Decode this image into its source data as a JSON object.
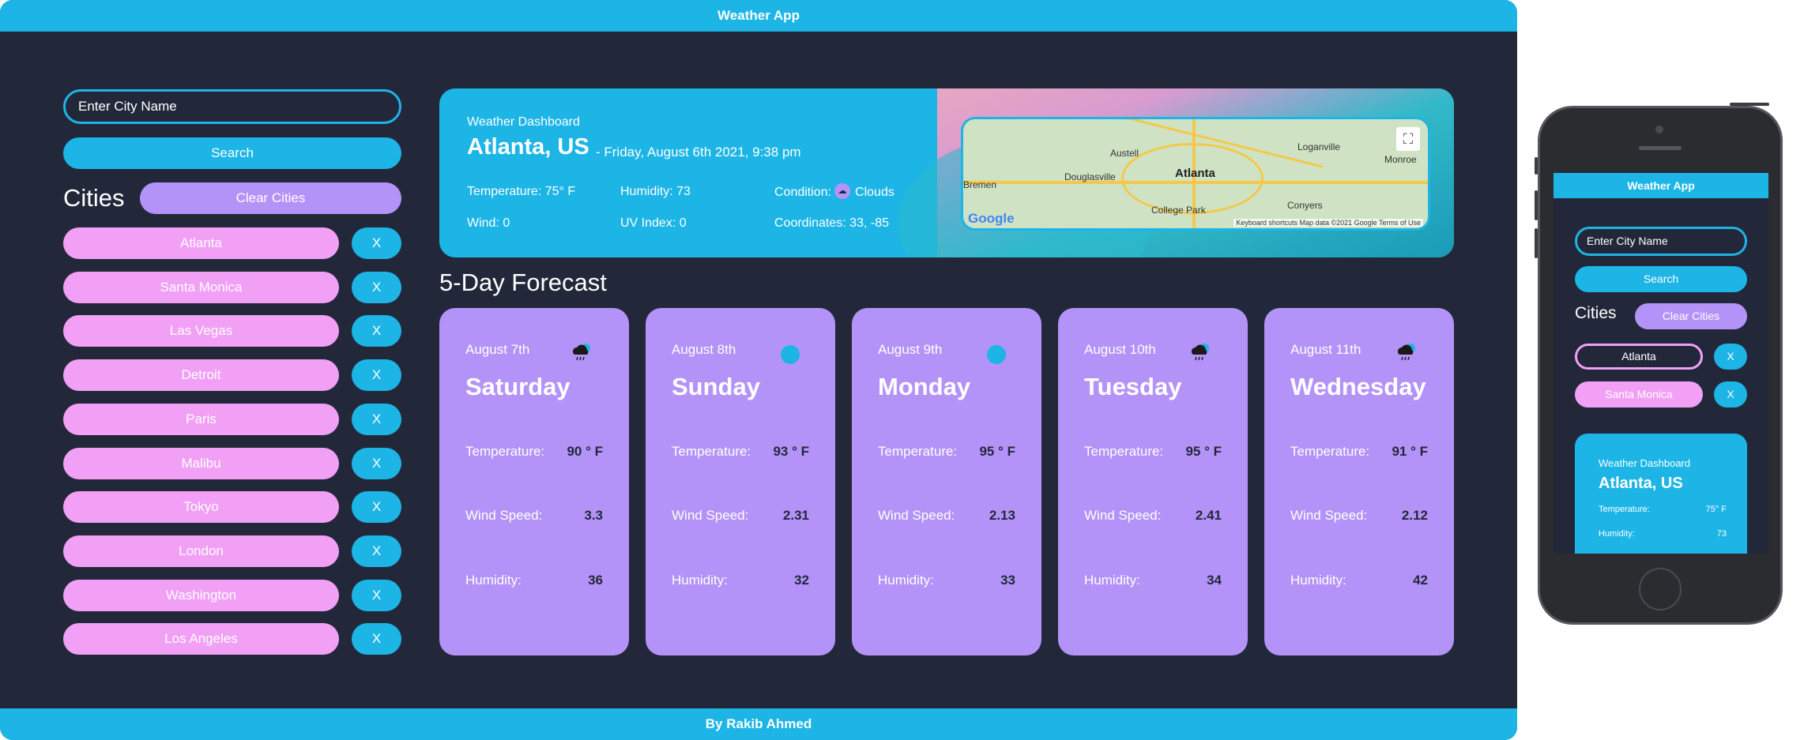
{
  "app": {
    "title": "Weather App",
    "footer": "By Rakib Ahmed"
  },
  "search": {
    "placeholder": "Enter City Name",
    "button": "Search"
  },
  "cities": {
    "heading": "Cities",
    "clear_label": "Clear Cities",
    "remove_label": "X",
    "items": [
      "Atlanta",
      "Santa Monica",
      "Las Vegas",
      "Detroit",
      "Paris",
      "Malibu",
      "Tokyo",
      "London",
      "Washington",
      "Los Angeles"
    ]
  },
  "dashboard": {
    "subtitle": "Weather Dashboard",
    "city": "Atlanta, US",
    "date": "- Friday, August 6th 2021, 9:38 pm",
    "temperature_label": "Temperature:",
    "temperature": "75° F",
    "humidity_label": "Humidity:",
    "humidity": "73",
    "condition_label": "Condition:",
    "condition": "Clouds",
    "wind_label": "Wind:",
    "wind": "0",
    "uv_label": "UV Index:",
    "uv": "0",
    "coords_label": "Coordinates:",
    "coords": "33, -85"
  },
  "map": {
    "city_label": "Atlanta",
    "places": [
      "Austell",
      "Douglasville",
      "Loganville",
      "Bremen",
      "College Park",
      "Conyers",
      "Monroe"
    ],
    "google": "Google",
    "footer_text": "Keyboard shortcuts   Map data ©2021 Google   Terms of Use"
  },
  "forecast": {
    "title": "5-Day Forecast",
    "labels": {
      "temperature": "Temperature:",
      "wind": "Wind Speed:",
      "humidity": "Humidity:"
    },
    "days": [
      {
        "date": "August 7th",
        "day": "Saturday",
        "icon": "rain-cloud-icon",
        "temp": "90 ° F",
        "wind": "3.3",
        "humidity": "36"
      },
      {
        "date": "August 8th",
        "day": "Sunday",
        "icon": "sun-icon",
        "temp": "93 ° F",
        "wind": "2.31",
        "humidity": "32"
      },
      {
        "date": "August 9th",
        "day": "Monday",
        "icon": "sun-icon",
        "temp": "95 ° F",
        "wind": "2.13",
        "humidity": "33"
      },
      {
        "date": "August 10th",
        "day": "Tuesday",
        "icon": "rain-cloud-icon",
        "temp": "95 ° F",
        "wind": "2.41",
        "humidity": "34"
      },
      {
        "date": "August 11th",
        "day": "Wednesday",
        "icon": "rain-cloud-icon",
        "temp": "91 ° F",
        "wind": "2.12",
        "humidity": "42"
      }
    ]
  },
  "phone": {
    "title": "Weather App",
    "placeholder": "Enter City Name",
    "search": "Search",
    "cities_heading": "Cities",
    "clear_label": "Clear Cities",
    "remove_label": "X",
    "cities": [
      "Atlanta",
      "Santa Monica"
    ],
    "dashboard_subtitle": "Weather Dashboard",
    "dashboard_city": "Atlanta, US",
    "temperature_label": "Temperature:",
    "temperature": "75° F",
    "humidity_label": "Humidity:",
    "humidity": "73"
  },
  "colors": {
    "primary": "#1cb5e6",
    "purple": "#b493f8",
    "pink": "#f1a0f6",
    "background": "#22283a"
  }
}
